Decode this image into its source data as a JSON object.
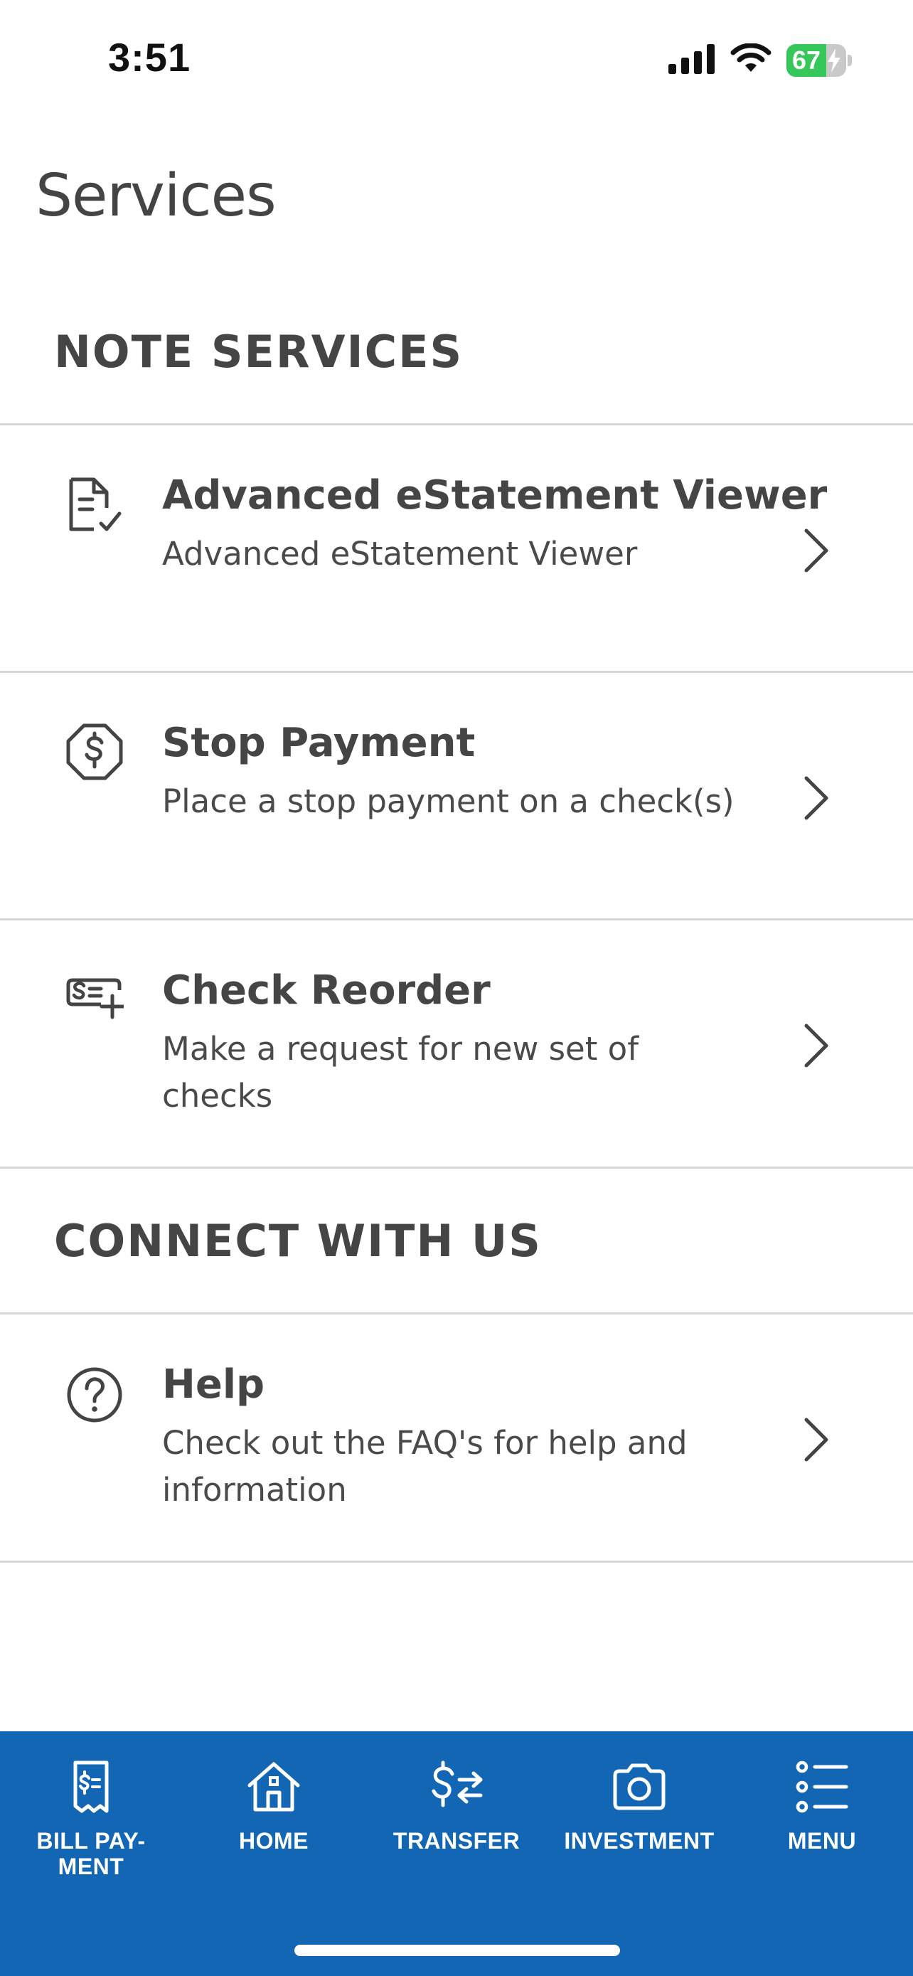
{
  "status_bar": {
    "time": "3:51",
    "battery_level": "67",
    "battery_fraction": 0.67,
    "battery_color": "#35c759",
    "icons": [
      "cellular-signal-icon",
      "wifi-icon",
      "battery-icon"
    ]
  },
  "page": {
    "title": "Services"
  },
  "sections": {
    "note_services": {
      "heading": "NOTE SERVICES",
      "items": [
        {
          "title": "Advanced eStatement Viewer",
          "description": "Advanced eStatement Viewer",
          "icon": "document-check-icon"
        },
        {
          "title": "Stop Payment",
          "description": "Place a stop payment on a check(s)",
          "icon": "stop-dollar-icon"
        },
        {
          "title": "Check Reorder",
          "description": "Make a request for new set of checks",
          "icon": "check-add-icon"
        }
      ]
    },
    "connect": {
      "heading": "CONNECT WITH US",
      "items": [
        {
          "title": "Help",
          "description": "Check out the FAQ's for help and information",
          "icon": "help-circle-icon"
        }
      ]
    }
  },
  "bottom_nav": {
    "background_color": "#1266b3",
    "items": [
      {
        "label": "BILL PAY-MENT",
        "icon": "bill-receipt-icon"
      },
      {
        "label": "HOME",
        "icon": "home-icon"
      },
      {
        "label": "TRANSFER",
        "icon": "transfer-icon"
      },
      {
        "label": "INVESTMENT",
        "icon": "camera-icon"
      },
      {
        "label": "MENU",
        "icon": "menu-list-icon"
      }
    ]
  }
}
